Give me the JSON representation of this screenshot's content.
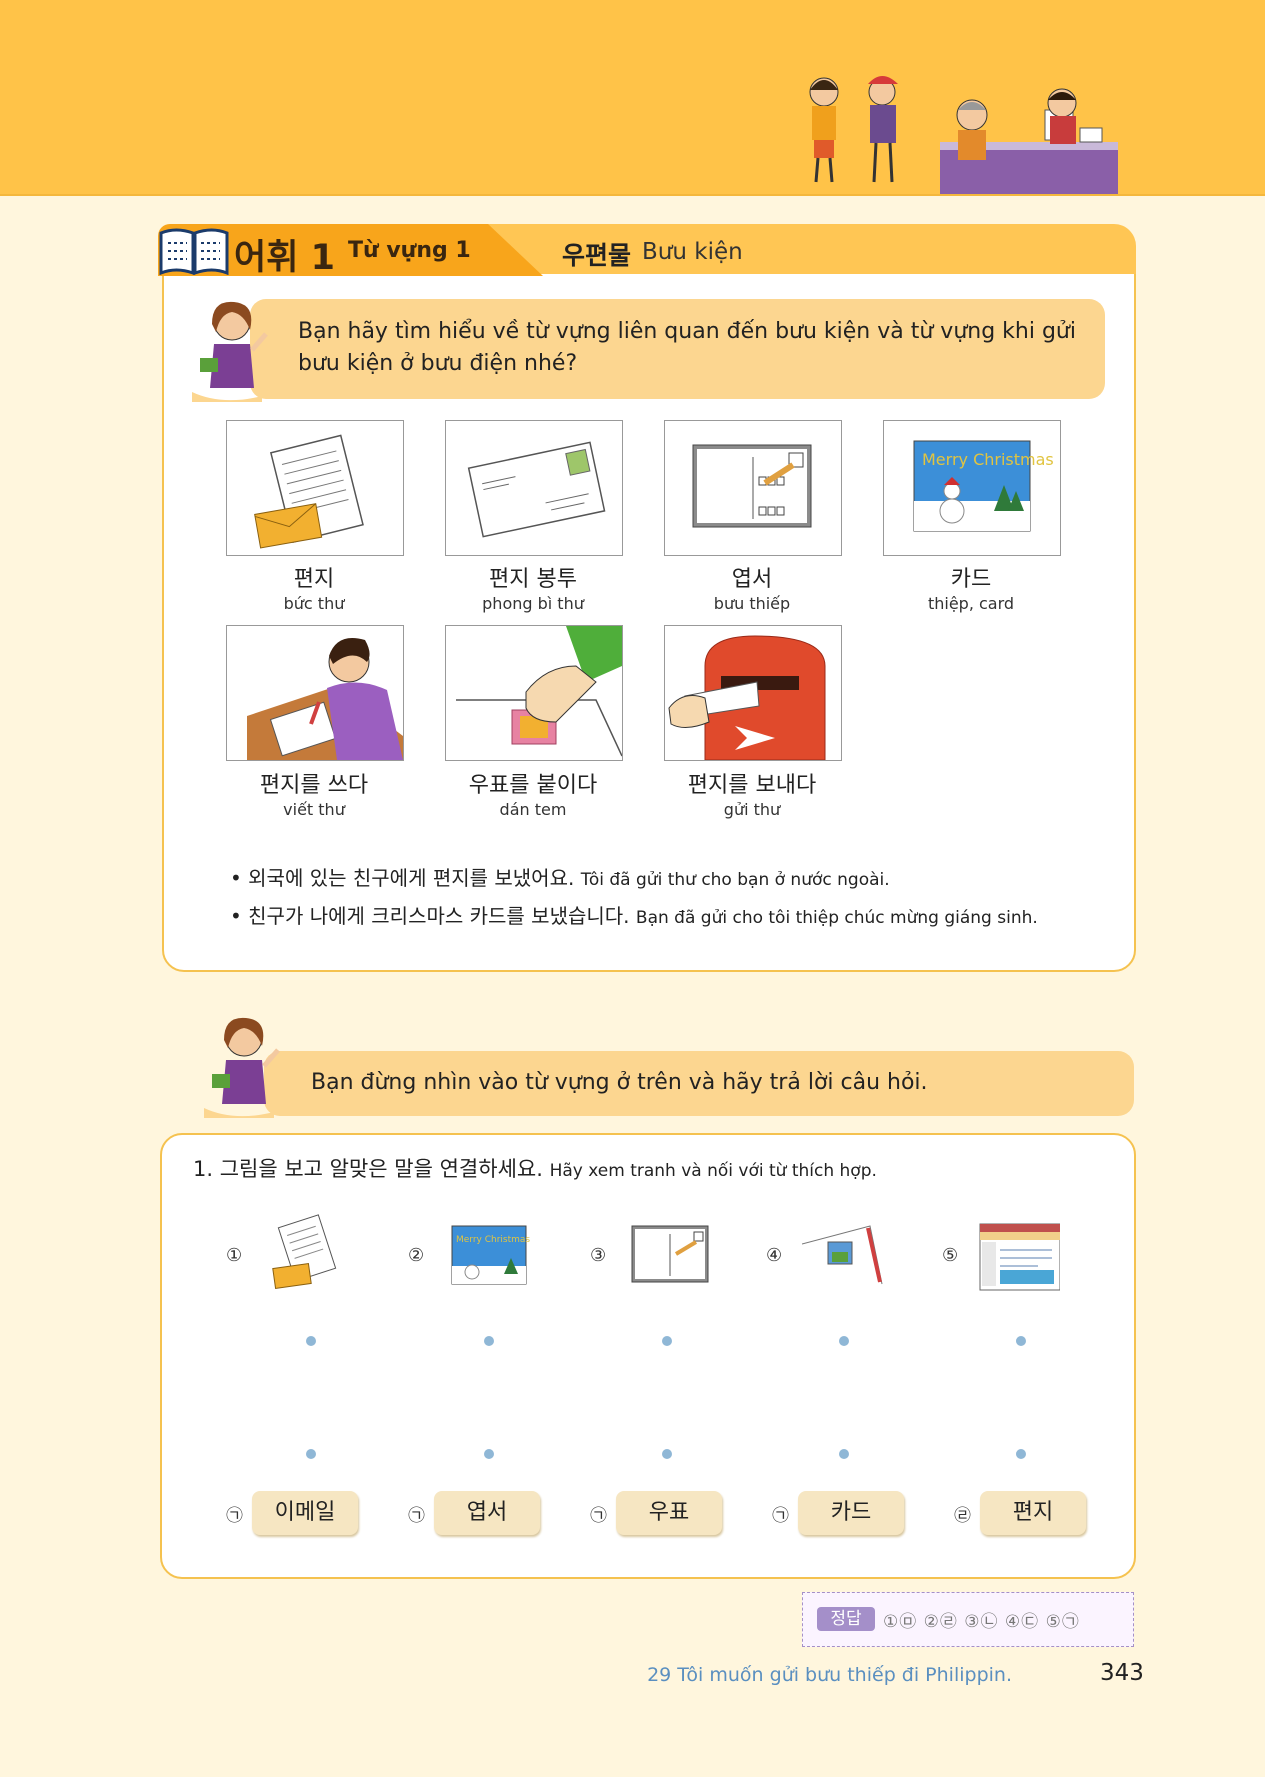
{
  "header": {
    "title": "어휘 1",
    "subtitle": "Từ vựng 1",
    "topic_ko": "우편물",
    "topic_vi": "Bưu kiện"
  },
  "intro": {
    "text": "Bạn hãy tìm hiểu về từ vựng liên quan đến bưu kiện và từ vựng khi gửi bưu kiện ở bưu điện nhé?"
  },
  "vocab": [
    {
      "ko": "편지",
      "vi": "bức thư",
      "icon": "letter-icon"
    },
    {
      "ko": "편지 봉투",
      "vi": "phong bì thư",
      "icon": "envelope-icon"
    },
    {
      "ko": "엽서",
      "vi": "bưu thiếp",
      "icon": "postcard-icon"
    },
    {
      "ko": "카드",
      "vi": "thiệp, card",
      "icon": "christmas-card-icon"
    },
    {
      "ko": "편지를 쓰다",
      "vi": "viết thư",
      "icon": "writing-letter-icon"
    },
    {
      "ko": "우표를 붙이다",
      "vi": "dán tem",
      "icon": "stamp-icon"
    },
    {
      "ko": "편지를 보내다",
      "vi": "gửi thư",
      "icon": "mailbox-icon"
    }
  ],
  "examples": [
    {
      "ko": "• 외국에 있는 친구에게 편지를 보냈어요.",
      "vi": "Tôi đã gửi thư cho bạn ở nước ngoài."
    },
    {
      "ko": "• 친구가 나에게 크리스마스 카드를 보냈습니다.",
      "vi": "Bạn đã gửi cho tôi thiệp chúc mừng giáng sinh."
    }
  ],
  "instruction": {
    "text": "Bạn đừng nhìn vào từ vựng ở trên và hãy trả lời câu hỏi."
  },
  "exercise": {
    "question_ko": "1. 그림을 보고 알맞은 말을 연결하세요.",
    "question_vi": "Hãy xem tranh và nối với từ thích hợp.",
    "numbers": [
      "①",
      "②",
      "③",
      "④",
      "⑤"
    ],
    "options": [
      {
        "mark": "㉠",
        "label": "이메일"
      },
      {
        "mark": "㉠",
        "label": "엽서"
      },
      {
        "mark": "㉠",
        "label": "우표"
      },
      {
        "mark": "㉠",
        "label": "카드"
      },
      {
        "mark": "㉣",
        "label": "편지"
      }
    ]
  },
  "answer": {
    "tag": "정답",
    "text": "①㉤ ②㉣ ③㉡ ④㉢ ⑤㉠"
  },
  "footer": {
    "lesson": "29 Tôi muốn gửi bưu thiếp đi Philippin.",
    "page": "343"
  },
  "colors": {
    "band": "#ffc348",
    "accent": "#f8a51b",
    "bubble": "#fcd690",
    "background": "#fff6dd"
  }
}
